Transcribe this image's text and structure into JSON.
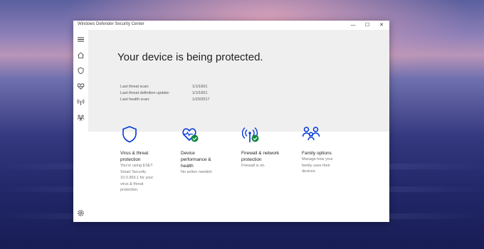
{
  "window": {
    "title": "Windows Defender Security Center",
    "controls": {
      "minimize": "—",
      "maximize": "☐",
      "close": "✕"
    }
  },
  "sidebar": {
    "items": [
      {
        "name": "menu",
        "icon": "hamburger-icon"
      },
      {
        "name": "home",
        "icon": "home-icon"
      },
      {
        "name": "virus-threat-protection",
        "icon": "shield-icon"
      },
      {
        "name": "device-performance-health",
        "icon": "heart-icon"
      },
      {
        "name": "firewall-network-protection",
        "icon": "wifi-icon"
      },
      {
        "name": "family-options",
        "icon": "family-icon"
      },
      {
        "name": "settings",
        "icon": "gear-icon"
      }
    ]
  },
  "status": {
    "headline": "Your device is being protected.",
    "rows": [
      {
        "label": "Last threat scan:",
        "value": "1/1/1601"
      },
      {
        "label": "Last threat definition update:",
        "value": "1/1/1601"
      },
      {
        "label": "Last health scan:",
        "value": "1/23/2017"
      }
    ]
  },
  "cards": [
    {
      "title_lines": [
        "Virus & threat",
        "protection"
      ],
      "desc_lines": [
        "You're using ESET",
        "Smart Security",
        "10.0.369.1 for your",
        "virus & threat",
        "protection."
      ],
      "icon": "shield-icon"
    },
    {
      "title_lines": [
        "Device",
        "performance &",
        "health"
      ],
      "desc_lines": [
        "No action needed."
      ],
      "icon": "heart-check-icon"
    },
    {
      "title_lines": [
        "Firewall & network",
        "protection"
      ],
      "desc_lines": [
        "Firewall is on."
      ],
      "icon": "wifi-check-icon"
    },
    {
      "title_lines": [
        "Family options"
      ],
      "desc_lines": [
        "Manage how your",
        "family uses their",
        "devices."
      ],
      "icon": "family-icon"
    }
  ],
  "colors": {
    "accent": "#0037DA",
    "ok": "#10893E",
    "hero_bg": "#EFEFEF"
  }
}
